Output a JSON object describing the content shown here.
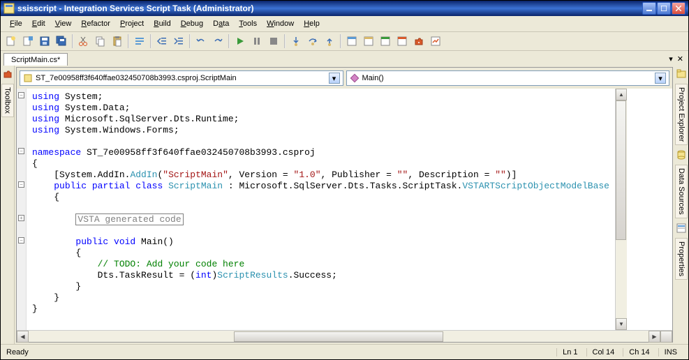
{
  "titlebar": {
    "text": "ssisscript - Integration Services Script Task (Administrator)"
  },
  "menu": {
    "file": "File",
    "edit": "Edit",
    "view": "View",
    "refactor": "Refactor",
    "project": "Project",
    "build": "Build",
    "debug": "Debug",
    "data": "Data",
    "tools": "Tools",
    "window": "Window",
    "help": "Help"
  },
  "tab": {
    "name": "ScriptMain.cs*"
  },
  "dd": {
    "left": "ST_7e00958ff3f640ffae032450708b3993.csproj.ScriptMain",
    "right": "Main()"
  },
  "side": {
    "toolbox": "Toolbox",
    "projexp": "Project Explorer",
    "datasrc": "Data Sources",
    "props": "Properties"
  },
  "code": {
    "usings": [
      "using System;",
      "using System.Data;",
      "using Microsoft.SqlServer.Dts.Runtime;",
      "using System.Windows.Forms;"
    ],
    "ns": "namespace ST_7e00958ff3f640ffae032450708b3993.csproj",
    "attr_pre": "[System.AddIn.",
    "attr_addin": "AddIn",
    "attr_args": "(\"ScriptMain\", Version = \"1.0\", Publisher = \"\", Description = \"\")]",
    "cls_pre": "public partial class ",
    "cls_name": "ScriptMain",
    "cls_base": " : Microsoft.SqlServer.Dts.Tasks.ScriptTask.",
    "cls_vsta": "VSTARTScriptObjectModelBase",
    "region": "VSTA generated code",
    "mainSig": "public void Main()",
    "todo": "// TODO: Add your code here",
    "result_pre": "Dts.TaskResult = (",
    "result_int": "int",
    "result_sr": ") ScriptResults",
    "result_suc": ".Success;"
  },
  "status": {
    "ready": "Ready",
    "ln": "Ln 1",
    "col": "Col 14",
    "ch": "Ch 14",
    "ins": "INS"
  }
}
